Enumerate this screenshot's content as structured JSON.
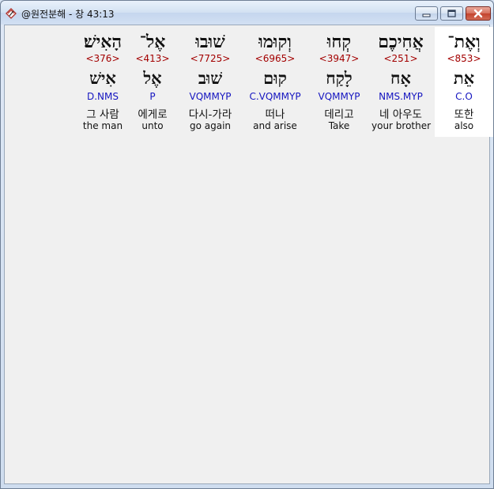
{
  "window": {
    "title": "@원전분해 - 창 43:13",
    "icon": "app-book-icon",
    "buttons": {
      "minimize": "minimize-icon",
      "maximize": "maximize-icon",
      "close": "close-icon"
    }
  },
  "words": [
    {
      "surface": "וְאֶת־",
      "strong": "<853>",
      "lemma": "אֵת",
      "parse": "C.O",
      "korean": "또한",
      "english": "also",
      "selected": true
    },
    {
      "surface": "אֲחִיכֶם",
      "strong": "<251>",
      "lemma": "אָח",
      "parse": "NMS.MYP",
      "korean": "네 아우도",
      "english": "your brother",
      "selected": false
    },
    {
      "surface": "קְחוּ",
      "strong": "<3947>",
      "lemma": "לָקַח",
      "parse": "VQMMYP",
      "korean": "데리고",
      "english": "Take",
      "selected": false
    },
    {
      "surface": "וְקוּמוּ",
      "strong": "<6965>",
      "lemma": "קוּם",
      "parse": "C.VQMMYP",
      "korean": "떠나",
      "english": "and arise",
      "selected": false
    },
    {
      "surface": "שׁוּבוּ",
      "strong": "<7725>",
      "lemma": "שׁוּב",
      "parse": "VQMMYP",
      "korean": "다시-가라",
      "english": "go again",
      "selected": false
    },
    {
      "surface": "אֶל־",
      "strong": "<413>",
      "lemma": "אֶל",
      "parse": "P",
      "korean": "에게로",
      "english": "unto",
      "selected": false
    },
    {
      "surface": "הָאִישׁ׃",
      "strong": "<376>",
      "lemma": "אִישׁ",
      "parse": "D.NMS",
      "korean": "그 사람",
      "english": "the man",
      "selected": false
    }
  ],
  "colors": {
    "strong": "#a30000",
    "parse": "#1515c0",
    "selected_background": "#ffffff",
    "background": "#f0f0f0"
  }
}
